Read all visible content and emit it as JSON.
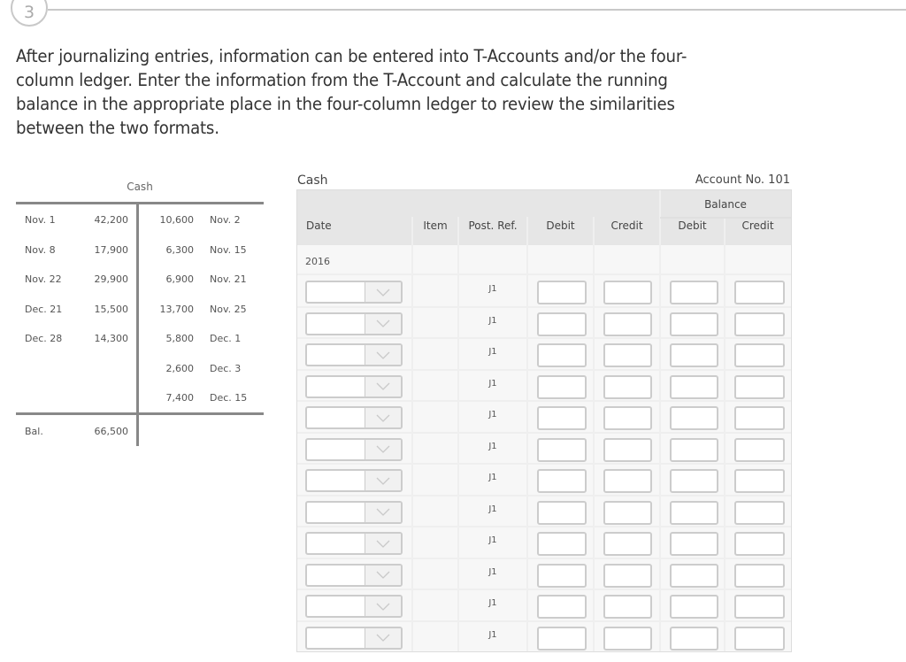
{
  "step": {
    "number": "3"
  },
  "instructions": "After journalizing entries, information can be entered into T-Accounts and/or the four-column ledger. Enter the information from the T-Account and calculate the running balance in the appropriate place in the four-column ledger to review the similarities between the two formats.",
  "t_account": {
    "title": "Cash",
    "debits": [
      {
        "date": "Nov. 1",
        "amount": "42,200"
      },
      {
        "date": "Nov. 8",
        "amount": "17,900"
      },
      {
        "date": "Nov. 22",
        "amount": "29,900"
      },
      {
        "date": "Dec. 21",
        "amount": "15,500"
      },
      {
        "date": "Dec. 28",
        "amount": "14,300"
      }
    ],
    "credits": [
      {
        "amount": "10,600",
        "date": "Nov. 2"
      },
      {
        "amount": "6,300",
        "date": "Nov. 15"
      },
      {
        "amount": "6,900",
        "date": "Nov. 21"
      },
      {
        "amount": "13,700",
        "date": "Nov. 25"
      },
      {
        "amount": "5,800",
        "date": "Dec. 1"
      },
      {
        "amount": "2,600",
        "date": "Dec. 3"
      },
      {
        "amount": "7,400",
        "date": "Dec. 15"
      }
    ],
    "balance": {
      "label": "Bal.",
      "amount": "66,500"
    }
  },
  "ledger": {
    "title": "Cash",
    "account_no": "Account No. 101",
    "headers": {
      "date": "Date",
      "item": "Item",
      "post_ref": "Post. Ref.",
      "debit": "Debit",
      "credit": "Credit",
      "balance": "Balance",
      "balance_debit": "Debit",
      "balance_credit": "Credit"
    },
    "year": "2016",
    "rows": [
      {
        "date": "",
        "post_ref": "J1",
        "debit": "",
        "credit": "",
        "balance_debit": "",
        "balance_credit": ""
      },
      {
        "date": "",
        "post_ref": "J1",
        "debit": "",
        "credit": "",
        "balance_debit": "",
        "balance_credit": ""
      },
      {
        "date": "",
        "post_ref": "J1",
        "debit": "",
        "credit": "",
        "balance_debit": "",
        "balance_credit": ""
      },
      {
        "date": "",
        "post_ref": "J1",
        "debit": "",
        "credit": "",
        "balance_debit": "",
        "balance_credit": ""
      },
      {
        "date": "",
        "post_ref": "J1",
        "debit": "",
        "credit": "",
        "balance_debit": "",
        "balance_credit": ""
      },
      {
        "date": "",
        "post_ref": "J1",
        "debit": "",
        "credit": "",
        "balance_debit": "",
        "balance_credit": ""
      },
      {
        "date": "",
        "post_ref": "J1",
        "debit": "",
        "credit": "",
        "balance_debit": "",
        "balance_credit": ""
      },
      {
        "date": "",
        "post_ref": "J1",
        "debit": "",
        "credit": "",
        "balance_debit": "",
        "balance_credit": ""
      },
      {
        "date": "",
        "post_ref": "J1",
        "debit": "",
        "credit": "",
        "balance_debit": "",
        "balance_credit": ""
      },
      {
        "date": "",
        "post_ref": "J1",
        "debit": "",
        "credit": "",
        "balance_debit": "",
        "balance_credit": ""
      },
      {
        "date": "",
        "post_ref": "J1",
        "debit": "",
        "credit": "",
        "balance_debit": "",
        "balance_credit": ""
      },
      {
        "date": "",
        "post_ref": "J1",
        "debit": "",
        "credit": "",
        "balance_debit": "",
        "balance_credit": ""
      }
    ]
  }
}
